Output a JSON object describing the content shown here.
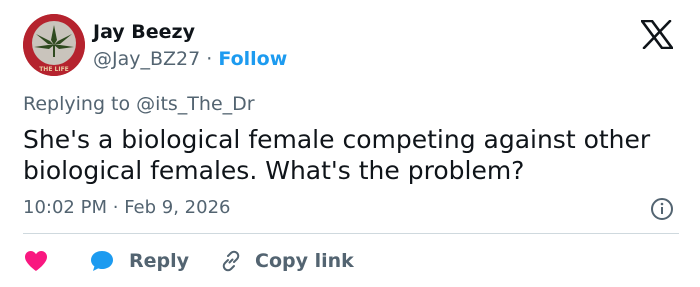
{
  "author": {
    "name": "Jay Beezy",
    "handle": "@Jay_BZ27",
    "separator": "·",
    "follow_label": "Follow",
    "avatar_caption": "THE LIFE"
  },
  "reply_context": {
    "prefix": "Replying to",
    "mention": "@its_The_Dr"
  },
  "tweet": {
    "text": "She's a biological female competing against other biological females. What's the problem?",
    "time": "10:02 PM",
    "separator": "·",
    "date": "Feb 9, 2026"
  },
  "actions": {
    "reply_label": "Reply",
    "copy_link_label": "Copy link"
  },
  "icons": {
    "brand": "x-logo-icon",
    "info": "info-icon",
    "like": "heart-icon",
    "reply": "reply-bubble-icon",
    "copy": "link-icon"
  },
  "colors": {
    "text": "#0f1419",
    "muted": "#536471",
    "accent": "#1d9bf0",
    "like": "#f91880",
    "divider": "#cfd9de",
    "avatar_bg": "#b5232e"
  }
}
